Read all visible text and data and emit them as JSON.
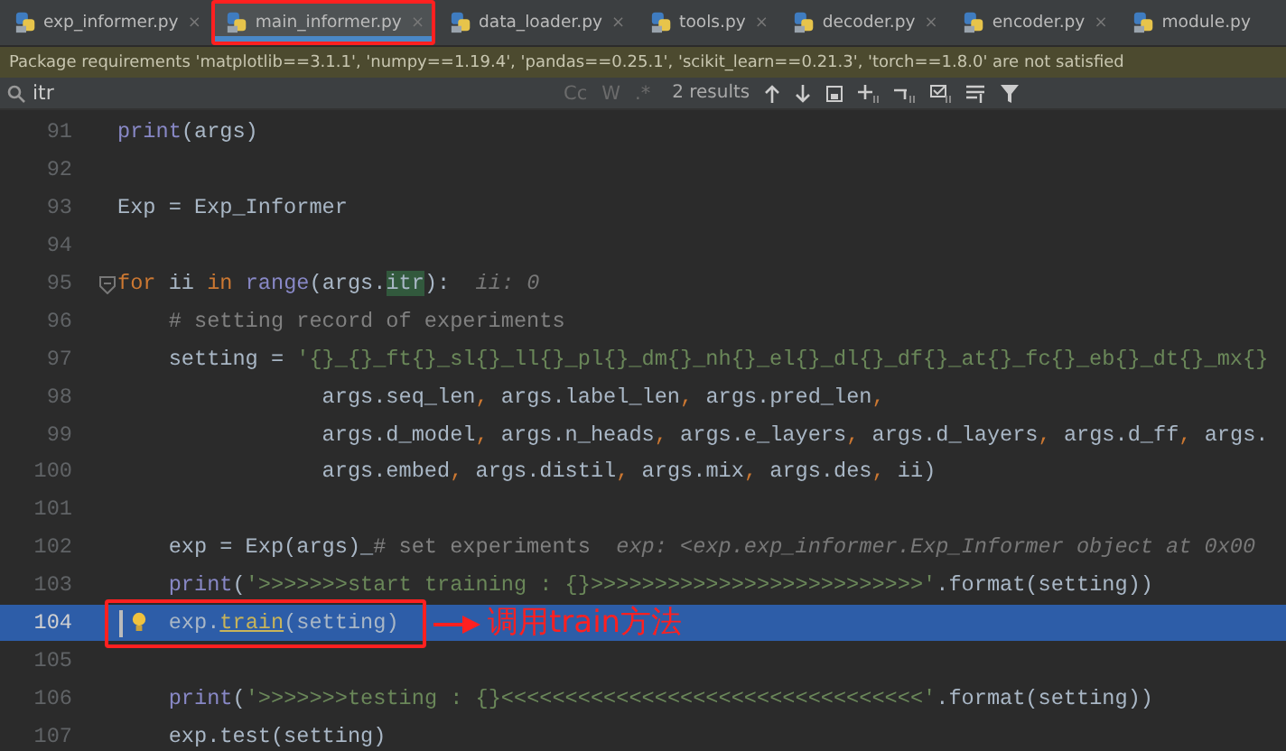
{
  "tabs": [
    {
      "label": "exp_informer.py",
      "close": "×",
      "selected": false,
      "outlined": false
    },
    {
      "label": "main_informer.py",
      "close": "×",
      "selected": true,
      "outlined": true
    },
    {
      "label": "data_loader.py",
      "close": "×",
      "selected": false,
      "outlined": false
    },
    {
      "label": "tools.py",
      "close": "×",
      "selected": false,
      "outlined": false
    },
    {
      "label": "decoder.py",
      "close": "×",
      "selected": false,
      "outlined": false
    },
    {
      "label": "encoder.py",
      "close": "×",
      "selected": false,
      "outlined": false
    },
    {
      "label": "module.py",
      "selected": false,
      "outlined": false
    }
  ],
  "warning": "Package requirements 'matplotlib==3.1.1', 'numpy==1.19.4', 'pandas==0.25.1', 'scikit_learn==0.21.3', 'torch==1.8.0' are not satisfied",
  "search": {
    "value": "itr",
    "options": [
      "Cc",
      "W",
      ".*"
    ],
    "results": "2 results"
  },
  "lines": [
    {
      "number": "91",
      "selected": false,
      "outlined": false,
      "tokens": [
        {
          "text": "print",
          "kind": "builtin"
        },
        {
          "text": "(args)",
          "kind": "plain"
        }
      ]
    },
    {
      "number": "92",
      "selected": false,
      "outlined": false
    },
    {
      "number": "93",
      "selected": false,
      "outlined": false,
      "tokens": [
        {
          "text": "Exp = Exp_Informer",
          "kind": "plain"
        }
      ]
    },
    {
      "number": "94",
      "selected": false,
      "outlined": false
    },
    {
      "number": "95",
      "selected": false,
      "outlined": false,
      "fold": true,
      "tokens": [
        {
          "text": "for ",
          "kind": "keyword"
        },
        {
          "text": "ii ",
          "kind": "plain"
        },
        {
          "text": "in ",
          "kind": "keyword"
        },
        {
          "text": "range",
          "kind": "builtin"
        },
        {
          "text": "(args.",
          "kind": "plain"
        },
        {
          "text": "itr",
          "kind": "match"
        },
        {
          "text": "):  ",
          "kind": "plain"
        },
        {
          "text": "ii: 0",
          "kind": "hint"
        }
      ]
    },
    {
      "number": "96",
      "selected": false,
      "outlined": false,
      "tokens": [
        {
          "text": "    # setting record of experiments",
          "kind": "comment"
        }
      ]
    },
    {
      "number": "97",
      "selected": false,
      "outlined": false,
      "tokens": [
        {
          "text": "    setting = ",
          "kind": "plain"
        },
        {
          "text": "'{}_{}_ft{}_sl{}_ll{}_pl{}_dm{}_nh{}_el{}_dl{}_df{}_at{}_fc{}_eb{}_dt{}_mx{}",
          "kind": "string"
        }
      ]
    },
    {
      "number": "98",
      "selected": false,
      "outlined": false,
      "tokens": [
        {
          "text": "                args.seq_len",
          "kind": "plain"
        },
        {
          "text": ", ",
          "kind": "punct"
        },
        {
          "text": "args.label_len",
          "kind": "plain"
        },
        {
          "text": ", ",
          "kind": "punct"
        },
        {
          "text": "args.pred_len",
          "kind": "plain"
        },
        {
          "text": ",",
          "kind": "punct"
        }
      ]
    },
    {
      "number": "99",
      "selected": false,
      "outlined": false,
      "tokens": [
        {
          "text": "                args.d_model",
          "kind": "plain"
        },
        {
          "text": ", ",
          "kind": "punct"
        },
        {
          "text": "args.n_heads",
          "kind": "plain"
        },
        {
          "text": ", ",
          "kind": "punct"
        },
        {
          "text": "args.e_layers",
          "kind": "plain"
        },
        {
          "text": ", ",
          "kind": "punct"
        },
        {
          "text": "args.d_layers",
          "kind": "plain"
        },
        {
          "text": ", ",
          "kind": "punct"
        },
        {
          "text": "args.d_ff",
          "kind": "plain"
        },
        {
          "text": ", ",
          "kind": "punct"
        },
        {
          "text": "args.",
          "kind": "plain"
        }
      ]
    },
    {
      "number": "100",
      "selected": false,
      "outlined": false,
      "tokens": [
        {
          "text": "                args.embed",
          "kind": "plain"
        },
        {
          "text": ", ",
          "kind": "punct"
        },
        {
          "text": "args.distil",
          "kind": "plain"
        },
        {
          "text": ", ",
          "kind": "punct"
        },
        {
          "text": "args.mix",
          "kind": "plain"
        },
        {
          "text": ", ",
          "kind": "punct"
        },
        {
          "text": "args.des",
          "kind": "plain"
        },
        {
          "text": ", ",
          "kind": "punct"
        },
        {
          "text": "ii)",
          "kind": "plain"
        }
      ]
    },
    {
      "number": "101",
      "selected": false,
      "outlined": false
    },
    {
      "number": "102",
      "selected": false,
      "outlined": false,
      "tokens": [
        {
          "text": "    exp = Exp(args)_",
          "kind": "plain"
        },
        {
          "text": "# set experiments  ",
          "kind": "comment"
        },
        {
          "text": "exp: <exp.exp_informer.Exp_Informer object at 0x00",
          "kind": "hint"
        }
      ]
    },
    {
      "number": "103",
      "selected": false,
      "outlined": false,
      "tokens": [
        {
          "text": "    print",
          "kind": "builtin"
        },
        {
          "text": "(",
          "kind": "plain"
        },
        {
          "text": "'>>>>>>>start training : {}>>>>>>>>>>>>>>>>>>>>>>>>>>'",
          "kind": "string"
        },
        {
          "text": ".format(setting))",
          "kind": "plain"
        }
      ]
    },
    {
      "number": "104",
      "selected": true,
      "outlined": true,
      "bulb": true,
      "callout": "调用train方法",
      "tokens": [
        {
          "text": "    exp.",
          "kind": "plain"
        },
        {
          "text": "train",
          "kind": "usage"
        },
        {
          "text": "(setting)",
          "kind": "plain"
        }
      ]
    },
    {
      "number": "105",
      "selected": false,
      "outlined": false
    },
    {
      "number": "106",
      "selected": false,
      "outlined": false,
      "tokens": [
        {
          "text": "    print",
          "kind": "builtin"
        },
        {
          "text": "(",
          "kind": "plain"
        },
        {
          "text": "'>>>>>>>testing : {}<<<<<<<<<<<<<<<<<<<<<<<<<<<<<<<<<'",
          "kind": "string"
        },
        {
          "text": ".format(setting))",
          "kind": "plain"
        }
      ]
    },
    {
      "number": "107",
      "selected": false,
      "outlined": false,
      "tokens": [
        {
          "text": "    exp.test(setting)",
          "kind": "plain"
        }
      ]
    }
  ]
}
